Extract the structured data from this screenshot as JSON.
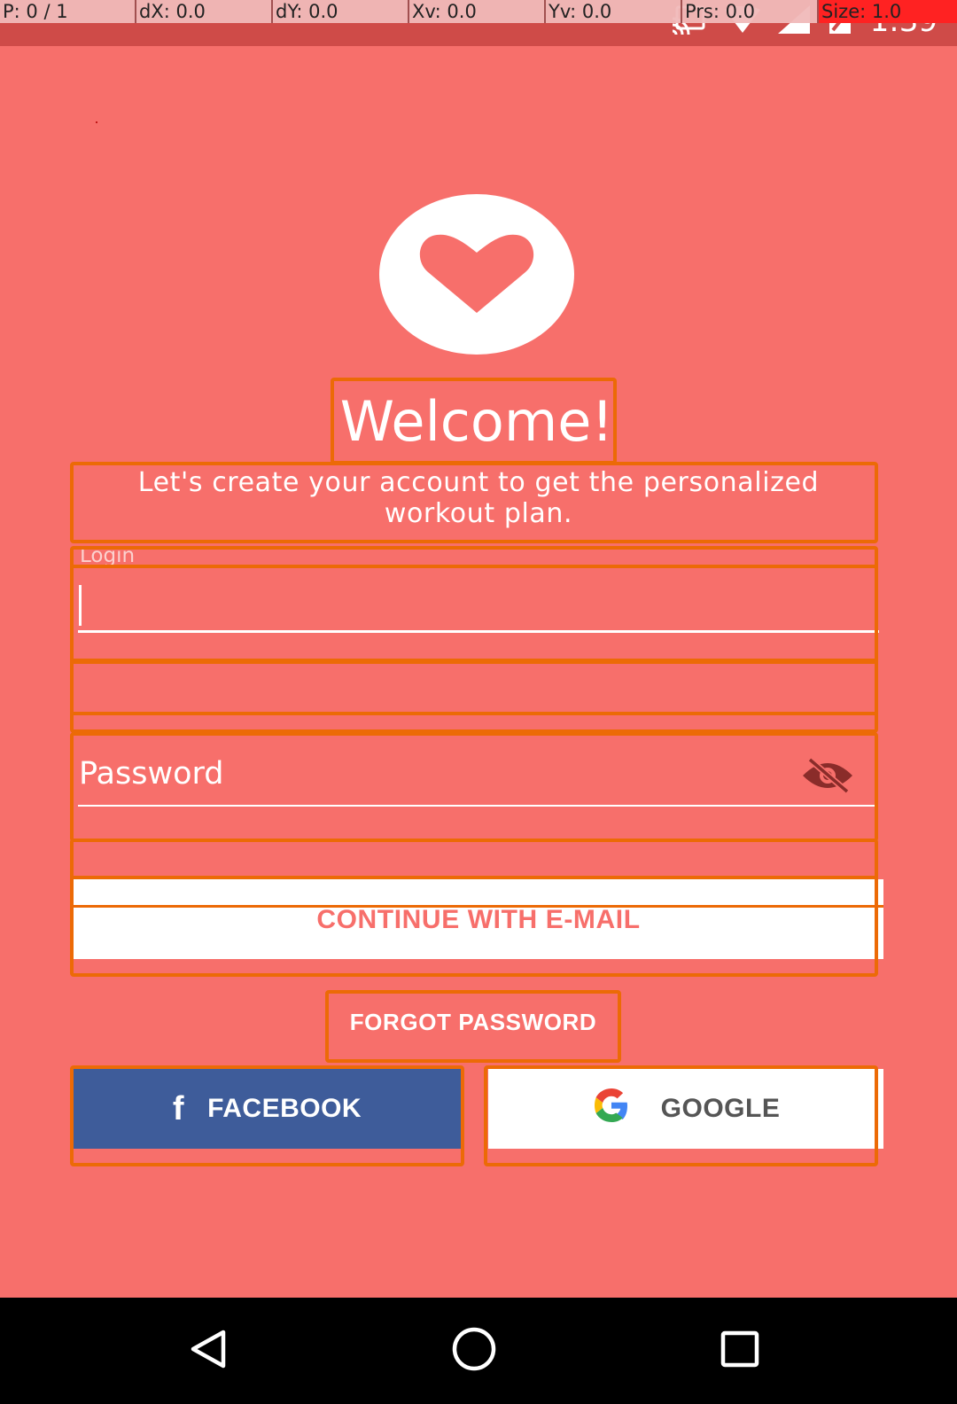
{
  "debug_overlay": {
    "pointer": "P: 0 / 1",
    "dx": "dX: 0.0",
    "dy": "dY: 0.0",
    "xv": "Xv: 0.0",
    "yv": "Yv: 0.0",
    "prs": "Prs: 0.0",
    "size": "Size: 1.0"
  },
  "status_bar": {
    "time": "1:39",
    "icons": [
      "cast-icon",
      "wifi-icon",
      "cell-signal-icon",
      "battery-icon"
    ]
  },
  "header": {
    "logo_icon": "heart-icon",
    "title": "Welcome!",
    "subtitle_line1": "Let's create your account to get the personalized",
    "subtitle_line2": "workout plan."
  },
  "form": {
    "login_label": "Login",
    "login_value": "",
    "password_label": "Password",
    "password_toggle_icon": "eye-off-icon",
    "continue_label": "CONTINUE WITH E-MAIL",
    "forgot_label": "FORGOT PASSWORD"
  },
  "social": {
    "facebook_label": "FACEBOOK",
    "facebook_icon": "facebook-icon",
    "google_label": "GOOGLE",
    "google_icon": "google-icon"
  },
  "nav": {
    "back_icon": "back-icon",
    "home_icon": "home-icon",
    "recents_icon": "recents-icon"
  },
  "colors": {
    "background": "#f76f6b",
    "status_bar": "#cf4b48",
    "debug_outline": "#ec6a06",
    "facebook": "#3e5c9a",
    "accent_text": "#f76f6b"
  }
}
